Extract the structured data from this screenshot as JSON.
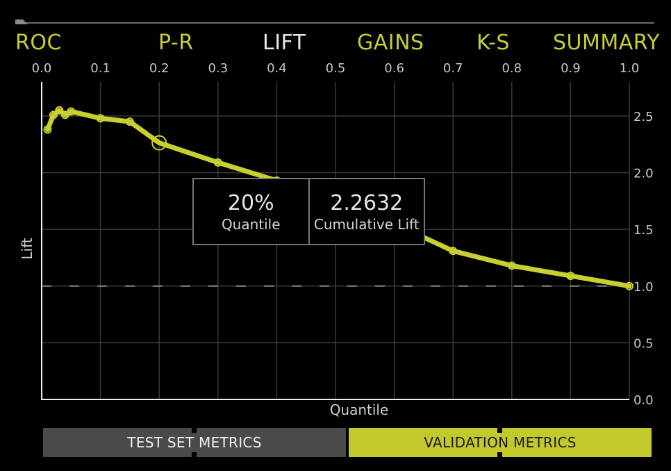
{
  "tabs": [
    {
      "label": "ROC",
      "active": false
    },
    {
      "label": "P-R",
      "active": false
    },
    {
      "label": "LIFT",
      "active": true
    },
    {
      "label": "GAINS",
      "active": false
    },
    {
      "label": "K-S",
      "active": false
    },
    {
      "label": "SUMMARY",
      "active": false
    }
  ],
  "colors": {
    "accent": "#c3c92b",
    "active_tab": "#e8e8e8",
    "line": "#c8cf2e",
    "grid": "#3a3a3a"
  },
  "tooltip": {
    "quantile_value": "20%",
    "quantile_label": "Quantile",
    "lift_value": "2.2632",
    "lift_label": "Cumulative Lift"
  },
  "buttons": {
    "test_set": "TEST SET METRICS",
    "validation": "VALIDATION METRICS"
  },
  "chart_data": {
    "type": "line",
    "xlabel": "Quantile",
    "ylabel": "Lift",
    "xlim": [
      0,
      1
    ],
    "ylim": [
      0,
      2.8
    ],
    "x_ticks": [
      "0.0",
      "0.1",
      "0.2",
      "0.3",
      "0.4",
      "0.5",
      "0.6",
      "0.7",
      "0.8",
      "0.9",
      "1.0"
    ],
    "y_ticks": [
      "0.0",
      "0.5",
      "1.0",
      "1.5",
      "2.0",
      "2.5"
    ],
    "x_axis_position": "top",
    "y_axis_position": "right",
    "grid": true,
    "reference_line": {
      "y": 1.0,
      "style": "dashed"
    },
    "highlighted_point": {
      "x": 0.2,
      "y": 2.2632
    },
    "series": [
      {
        "x": [
          0.01,
          0.02,
          0.03,
          0.04,
          0.05,
          0.1,
          0.15,
          0.2,
          0.3,
          0.4,
          0.5,
          0.6,
          0.7,
          0.8,
          0.9,
          1.0
        ],
        "y": [
          2.38,
          2.51,
          2.55,
          2.51,
          2.54,
          2.48,
          2.45,
          2.2632,
          2.09,
          1.93,
          1.77,
          1.55,
          1.31,
          1.18,
          1.09,
          1.0
        ]
      }
    ]
  }
}
